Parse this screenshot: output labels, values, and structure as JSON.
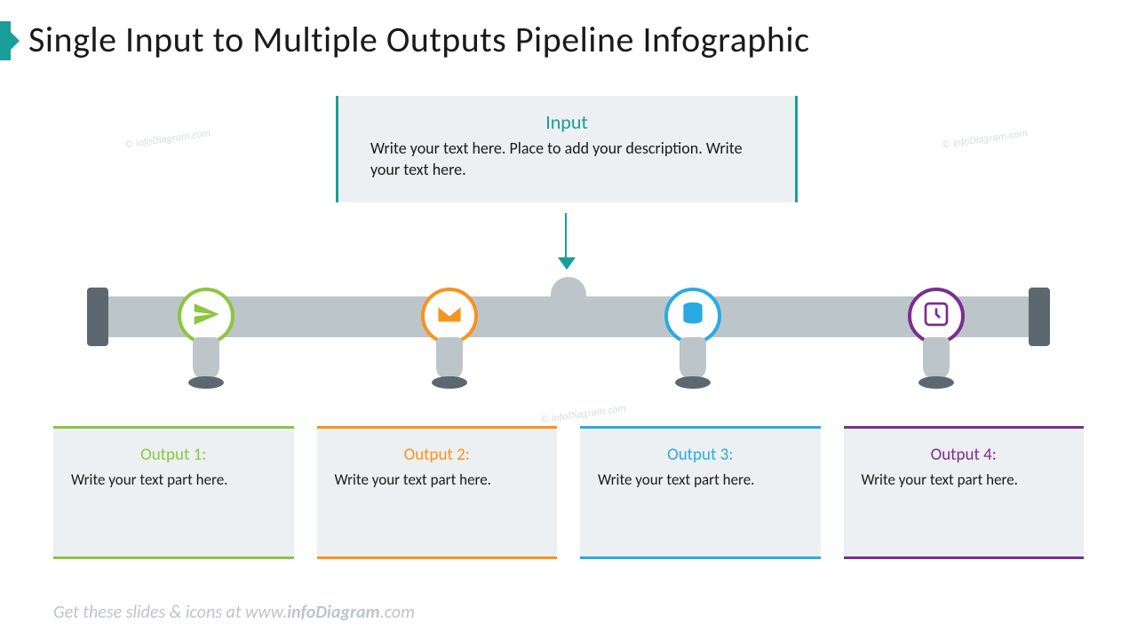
{
  "title": "Single Input to Multiple Outputs Pipeline Infographic",
  "input": {
    "title": "Input",
    "desc": "Write your text here. Place to add your description. Write your text here."
  },
  "colors": {
    "accent": "#1a9e99",
    "green": "#8cc63f",
    "orange": "#f7941d",
    "blue": "#29abe2",
    "purple": "#7b2e8e"
  },
  "outputs": [
    {
      "title": "Output 1:",
      "desc": "Write your text part here.",
      "icon": "paper-plane"
    },
    {
      "title": "Output 2:",
      "desc": "Write your text part here.",
      "icon": "envelope"
    },
    {
      "title": "Output 3:",
      "desc": "Write your text part here.",
      "icon": "database"
    },
    {
      "title": "Output 4:",
      "desc": "Write your text part here.",
      "icon": "clock"
    }
  ],
  "footer": {
    "prefix": "Get these slides & icons at www.",
    "bold": "infoDiagram",
    "suffix": ".com"
  },
  "watermark": "© infoDiagram.com"
}
